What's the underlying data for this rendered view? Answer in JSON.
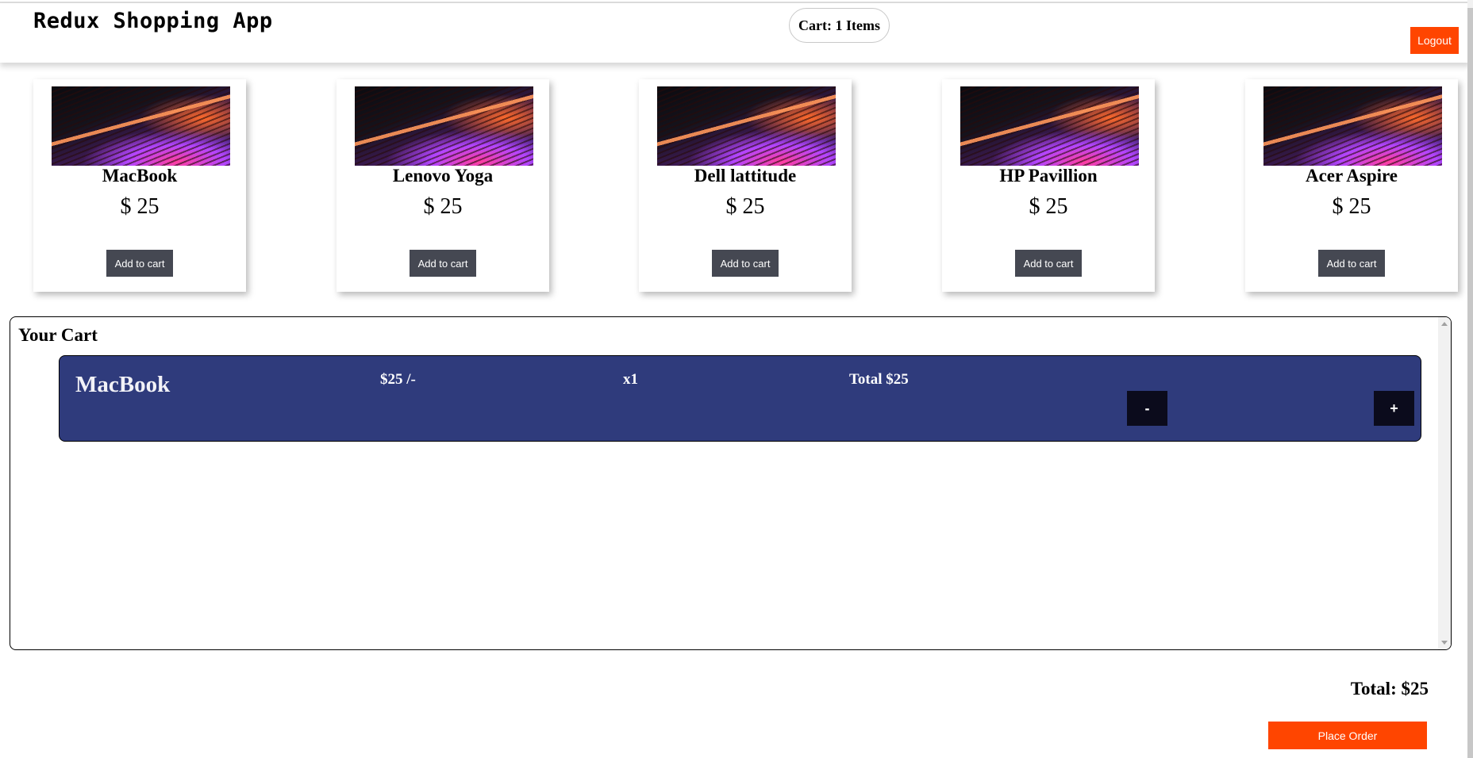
{
  "header": {
    "brand": "Redux Shopping App",
    "cart_label": "Cart: 1 Items",
    "logout_label": "Logout"
  },
  "products": [
    {
      "name": "MacBook",
      "price": "$ 25",
      "button": "Add to cart"
    },
    {
      "name": "Lenovo Yoga",
      "price": "$ 25",
      "button": "Add to cart"
    },
    {
      "name": "Dell lattitude",
      "price": "$ 25",
      "button": "Add to cart"
    },
    {
      "name": "HP Pavillion",
      "price": "$ 25",
      "button": "Add to cart"
    },
    {
      "name": "Acer Aspire",
      "price": "$ 25",
      "button": "Add to cart"
    }
  ],
  "cart": {
    "title": "Your Cart",
    "items": [
      {
        "name": "MacBook",
        "price": "$25 /-",
        "quantity": "x1",
        "total": "Total $25",
        "decrement": "-",
        "increment": "+"
      }
    ],
    "grand_total": "Total: $25",
    "place_order_label": "Place Order"
  },
  "colors": {
    "accent": "#ff4500",
    "cart_item_bg": "#2f3b7c",
    "add_button_bg": "#454852",
    "qty_button_bg": "#0b0b1c"
  }
}
